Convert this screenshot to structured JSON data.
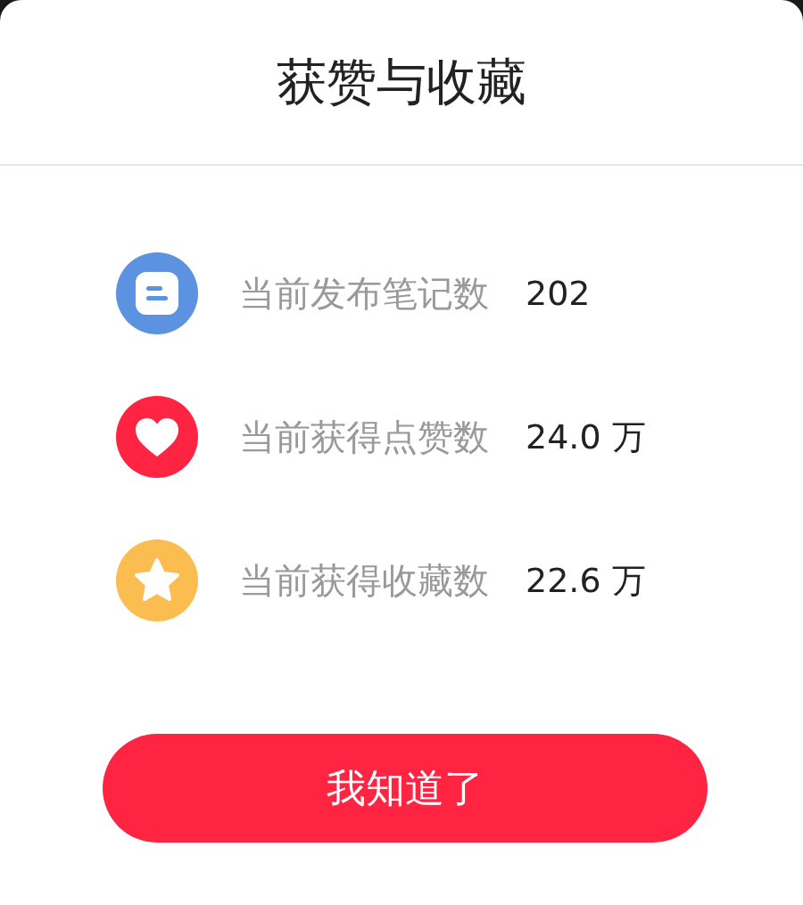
{
  "title": "获赞与收藏",
  "stats": [
    {
      "kind": "notes",
      "label": "当前发布笔记数",
      "value": "202"
    },
    {
      "kind": "likes",
      "label": "当前获得点赞数",
      "value": "24.0 万"
    },
    {
      "kind": "favorites",
      "label": "当前获得收藏数",
      "value": "22.6 万"
    }
  ],
  "button": "我知道了"
}
